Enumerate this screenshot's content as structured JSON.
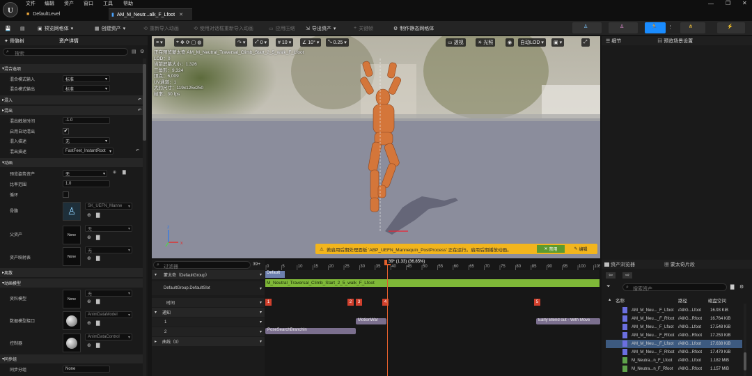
{
  "app": {
    "menus": [
      "文件",
      "编辑",
      "资产",
      "窗口",
      "工具",
      "帮助"
    ],
    "tabs": [
      "DefaultLevel",
      "AM_M_Neutr...alk_F_Lfoot"
    ]
  },
  "toolbar": {
    "preview_mesh": "预览网格体",
    "create_asset": "创建资产",
    "reimport": "重新导入动画",
    "reimport_all": "使用对话框重新导入动画",
    "apply_compression": "应用压缩",
    "export_asset": "导出资产",
    "add_key": "关键帧",
    "make_static_mesh": "制作静态网格体"
  },
  "left": {
    "tabs": [
      "骨骼树",
      "资产详情"
    ],
    "search_placeholder": "搜索",
    "sections": {
      "blend_options": "混合选项",
      "blend_in": "混入",
      "blend_out": "混出",
      "anim": "动画",
      "notify": "离散",
      "anim_model": "动画模型",
      "sync_group": "同步组"
    },
    "props": {
      "blend_in_mode": {
        "label": "混合模式输入",
        "value": "标准"
      },
      "blend_out_mode": {
        "label": "混合模式输出",
        "value": "标准"
      },
      "blend_out_trigger": {
        "label": "混出触发时间",
        "value": "-1.0"
      },
      "auto_blend_out": {
        "label": "启用自动混出"
      },
      "blend_in_desc": {
        "label": "混入描述",
        "value": "无"
      },
      "blend_out_desc": {
        "label": "混出描述",
        "value": "FastFeet_InstantRoot"
      },
      "preview_pose": {
        "label": "预览姿势资产",
        "value": "无"
      },
      "rate_scale": {
        "label": "比率范围",
        "value": "1.0"
      },
      "loop": {
        "label": "循环"
      },
      "skeleton": {
        "label": "骨骼",
        "value": "SK_UEFN_Manne"
      },
      "parent_asset": {
        "label": "父资产",
        "value": "无",
        "thumb": "None"
      },
      "asset_map": {
        "label": "资产映射表",
        "value": "无",
        "thumb": "None"
      },
      "asset_data": {
        "label": "资料模型",
        "value": "无",
        "thumb": "None"
      },
      "data_model_iface": {
        "label": "数据模型接口",
        "value": "AnimDataModel"
      },
      "controller": {
        "label": "控制器",
        "value": "AnimDataControl"
      },
      "sync_group_name": {
        "label": "同步分组",
        "value": "None"
      }
    }
  },
  "viewport": {
    "view_mode": "透视",
    "lit": "光照",
    "lod": "自动LOD",
    "snap_a": "0",
    "snap_b": "10",
    "snap_c": "10°",
    "snap_d": "0.25",
    "speed": "1",
    "stats": [
      "正在预览蒙太奇 AM_M_Neutral_Traversal_Climb_Start_2_5_walk_F_Lfoot",
      "LOD：0",
      "当前屏幕大小：1.326",
      "三角形：9,324",
      "顶点：6,009",
      "UV通道：1",
      "大约尺寸：119x125x250",
      "帧率：30 fps"
    ],
    "warning": "若启用后期处理面板 'ABP_UEFN_Mannequin_PostProcess' 正在运行。启用后期播放动画。",
    "warn_btn_disable": "禁用",
    "warn_btn_edit": "编辑"
  },
  "timeline": {
    "filter_placeholder": "过滤器",
    "counter": "39+",
    "playhead": "39* (1.33) (36.85%)",
    "montage_label": "蒙太奇（DefaultGroup）",
    "slot_label": "DefaultGroup.DefaultSlot",
    "time_label": "时间",
    "notify_label": "通知",
    "track1": "1",
    "track2": "2",
    "curves_label": "曲线（0）",
    "section_default": "Default",
    "segment_name": "M_Neutral_Traversal_Climb_Start_2_5_walk_F_Lfoot",
    "markers": [
      "1",
      "2",
      "3",
      "4",
      "5"
    ],
    "notifies": [
      "MotionWar",
      "Early Blend out - With Move",
      "PoseSearchBranchIn"
    ],
    "ticks": [
      "0",
      "5",
      "10",
      "15",
      "20",
      "25",
      "30",
      "35",
      "40",
      "45",
      "50",
      "55",
      "60",
      "65",
      "70",
      "75",
      "80",
      "85",
      "90",
      "95",
      "100",
      "105"
    ]
  },
  "right": {
    "tabs": [
      "细节",
      "预览场景设置"
    ],
    "browser_tabs": [
      "资产浏览器",
      "蒙太奇片段"
    ],
    "search_placeholder": "搜索资产",
    "cols": {
      "name": "名称",
      "path": "路径",
      "size": "磁盘空间"
    },
    "assets": [
      {
        "name": "AM_M_Neu..._F_Lfoot",
        "path": "/All/G...Lfoot",
        "size": "16.93 KiB"
      },
      {
        "name": "AM_M_Neu..._F_Rfoot",
        "path": "/All/G...Rfoot",
        "size": "16.764 KiB"
      },
      {
        "name": "AM_M_Neu..._F_Lfoot",
        "path": "/All/G...Lfoot",
        "size": "17.548 KiB"
      },
      {
        "name": "AM_M_Neu..._F_Rfoot",
        "path": "/All/G...Rfoot",
        "size": "17.253 KiB"
      },
      {
        "name": "AM_M_Neu..._F_Lfoot",
        "path": "/All/G...Lfoot",
        "size": "17.638 KiB"
      },
      {
        "name": "AM_M_Neu..._F_Rfoot",
        "path": "/All/G...Rfoot",
        "size": "17.479 KiB"
      },
      {
        "name": "M_Neutra...n_F_Lfoot",
        "path": "/All/G...Lfoot",
        "size": "1.182 MiB"
      },
      {
        "name": "M_Neutra...n_F_Rfoot",
        "path": "/All/G...Rfoot",
        "size": "1.157 MiB"
      }
    ]
  },
  "colors": {
    "accent_blue": "#1a8cff",
    "green_track": "#7fb838",
    "warning_yellow": "#f2b51d",
    "playhead_orange": "#e35f2c",
    "marker_red": "#d1402d"
  }
}
